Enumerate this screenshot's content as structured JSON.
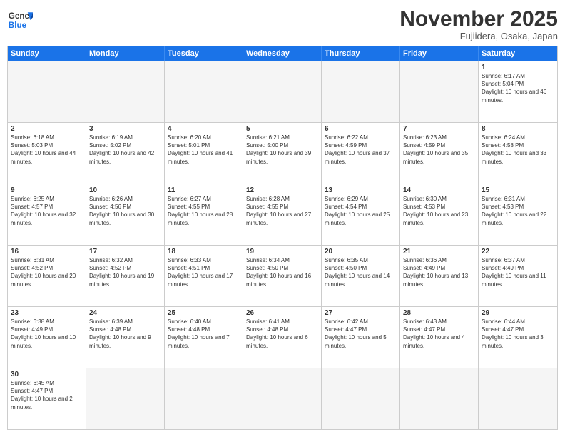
{
  "header": {
    "logo_general": "General",
    "logo_blue": "Blue",
    "month_title": "November 2025",
    "subtitle": "Fujiidera, Osaka, Japan"
  },
  "days_of_week": [
    "Sunday",
    "Monday",
    "Tuesday",
    "Wednesday",
    "Thursday",
    "Friday",
    "Saturday"
  ],
  "weeks": [
    [
      {
        "day": "",
        "info": ""
      },
      {
        "day": "",
        "info": ""
      },
      {
        "day": "",
        "info": ""
      },
      {
        "day": "",
        "info": ""
      },
      {
        "day": "",
        "info": ""
      },
      {
        "day": "",
        "info": ""
      },
      {
        "day": "1",
        "info": "Sunrise: 6:17 AM\nSunset: 5:04 PM\nDaylight: 10 hours and 46 minutes."
      }
    ],
    [
      {
        "day": "2",
        "info": "Sunrise: 6:18 AM\nSunset: 5:03 PM\nDaylight: 10 hours and 44 minutes."
      },
      {
        "day": "3",
        "info": "Sunrise: 6:19 AM\nSunset: 5:02 PM\nDaylight: 10 hours and 42 minutes."
      },
      {
        "day": "4",
        "info": "Sunrise: 6:20 AM\nSunset: 5:01 PM\nDaylight: 10 hours and 41 minutes."
      },
      {
        "day": "5",
        "info": "Sunrise: 6:21 AM\nSunset: 5:00 PM\nDaylight: 10 hours and 39 minutes."
      },
      {
        "day": "6",
        "info": "Sunrise: 6:22 AM\nSunset: 4:59 PM\nDaylight: 10 hours and 37 minutes."
      },
      {
        "day": "7",
        "info": "Sunrise: 6:23 AM\nSunset: 4:59 PM\nDaylight: 10 hours and 35 minutes."
      },
      {
        "day": "8",
        "info": "Sunrise: 6:24 AM\nSunset: 4:58 PM\nDaylight: 10 hours and 33 minutes."
      }
    ],
    [
      {
        "day": "9",
        "info": "Sunrise: 6:25 AM\nSunset: 4:57 PM\nDaylight: 10 hours and 32 minutes."
      },
      {
        "day": "10",
        "info": "Sunrise: 6:26 AM\nSunset: 4:56 PM\nDaylight: 10 hours and 30 minutes."
      },
      {
        "day": "11",
        "info": "Sunrise: 6:27 AM\nSunset: 4:55 PM\nDaylight: 10 hours and 28 minutes."
      },
      {
        "day": "12",
        "info": "Sunrise: 6:28 AM\nSunset: 4:55 PM\nDaylight: 10 hours and 27 minutes."
      },
      {
        "day": "13",
        "info": "Sunrise: 6:29 AM\nSunset: 4:54 PM\nDaylight: 10 hours and 25 minutes."
      },
      {
        "day": "14",
        "info": "Sunrise: 6:30 AM\nSunset: 4:53 PM\nDaylight: 10 hours and 23 minutes."
      },
      {
        "day": "15",
        "info": "Sunrise: 6:31 AM\nSunset: 4:53 PM\nDaylight: 10 hours and 22 minutes."
      }
    ],
    [
      {
        "day": "16",
        "info": "Sunrise: 6:31 AM\nSunset: 4:52 PM\nDaylight: 10 hours and 20 minutes."
      },
      {
        "day": "17",
        "info": "Sunrise: 6:32 AM\nSunset: 4:52 PM\nDaylight: 10 hours and 19 minutes."
      },
      {
        "day": "18",
        "info": "Sunrise: 6:33 AM\nSunset: 4:51 PM\nDaylight: 10 hours and 17 minutes."
      },
      {
        "day": "19",
        "info": "Sunrise: 6:34 AM\nSunset: 4:50 PM\nDaylight: 10 hours and 16 minutes."
      },
      {
        "day": "20",
        "info": "Sunrise: 6:35 AM\nSunset: 4:50 PM\nDaylight: 10 hours and 14 minutes."
      },
      {
        "day": "21",
        "info": "Sunrise: 6:36 AM\nSunset: 4:49 PM\nDaylight: 10 hours and 13 minutes."
      },
      {
        "day": "22",
        "info": "Sunrise: 6:37 AM\nSunset: 4:49 PM\nDaylight: 10 hours and 11 minutes."
      }
    ],
    [
      {
        "day": "23",
        "info": "Sunrise: 6:38 AM\nSunset: 4:49 PM\nDaylight: 10 hours and 10 minutes."
      },
      {
        "day": "24",
        "info": "Sunrise: 6:39 AM\nSunset: 4:48 PM\nDaylight: 10 hours and 9 minutes."
      },
      {
        "day": "25",
        "info": "Sunrise: 6:40 AM\nSunset: 4:48 PM\nDaylight: 10 hours and 7 minutes."
      },
      {
        "day": "26",
        "info": "Sunrise: 6:41 AM\nSunset: 4:48 PM\nDaylight: 10 hours and 6 minutes."
      },
      {
        "day": "27",
        "info": "Sunrise: 6:42 AM\nSunset: 4:47 PM\nDaylight: 10 hours and 5 minutes."
      },
      {
        "day": "28",
        "info": "Sunrise: 6:43 AM\nSunset: 4:47 PM\nDaylight: 10 hours and 4 minutes."
      },
      {
        "day": "29",
        "info": "Sunrise: 6:44 AM\nSunset: 4:47 PM\nDaylight: 10 hours and 3 minutes."
      }
    ],
    [
      {
        "day": "30",
        "info": "Sunrise: 6:45 AM\nSunset: 4:47 PM\nDaylight: 10 hours and 2 minutes."
      },
      {
        "day": "",
        "info": ""
      },
      {
        "day": "",
        "info": ""
      },
      {
        "day": "",
        "info": ""
      },
      {
        "day": "",
        "info": ""
      },
      {
        "day": "",
        "info": ""
      },
      {
        "day": "",
        "info": ""
      }
    ]
  ]
}
